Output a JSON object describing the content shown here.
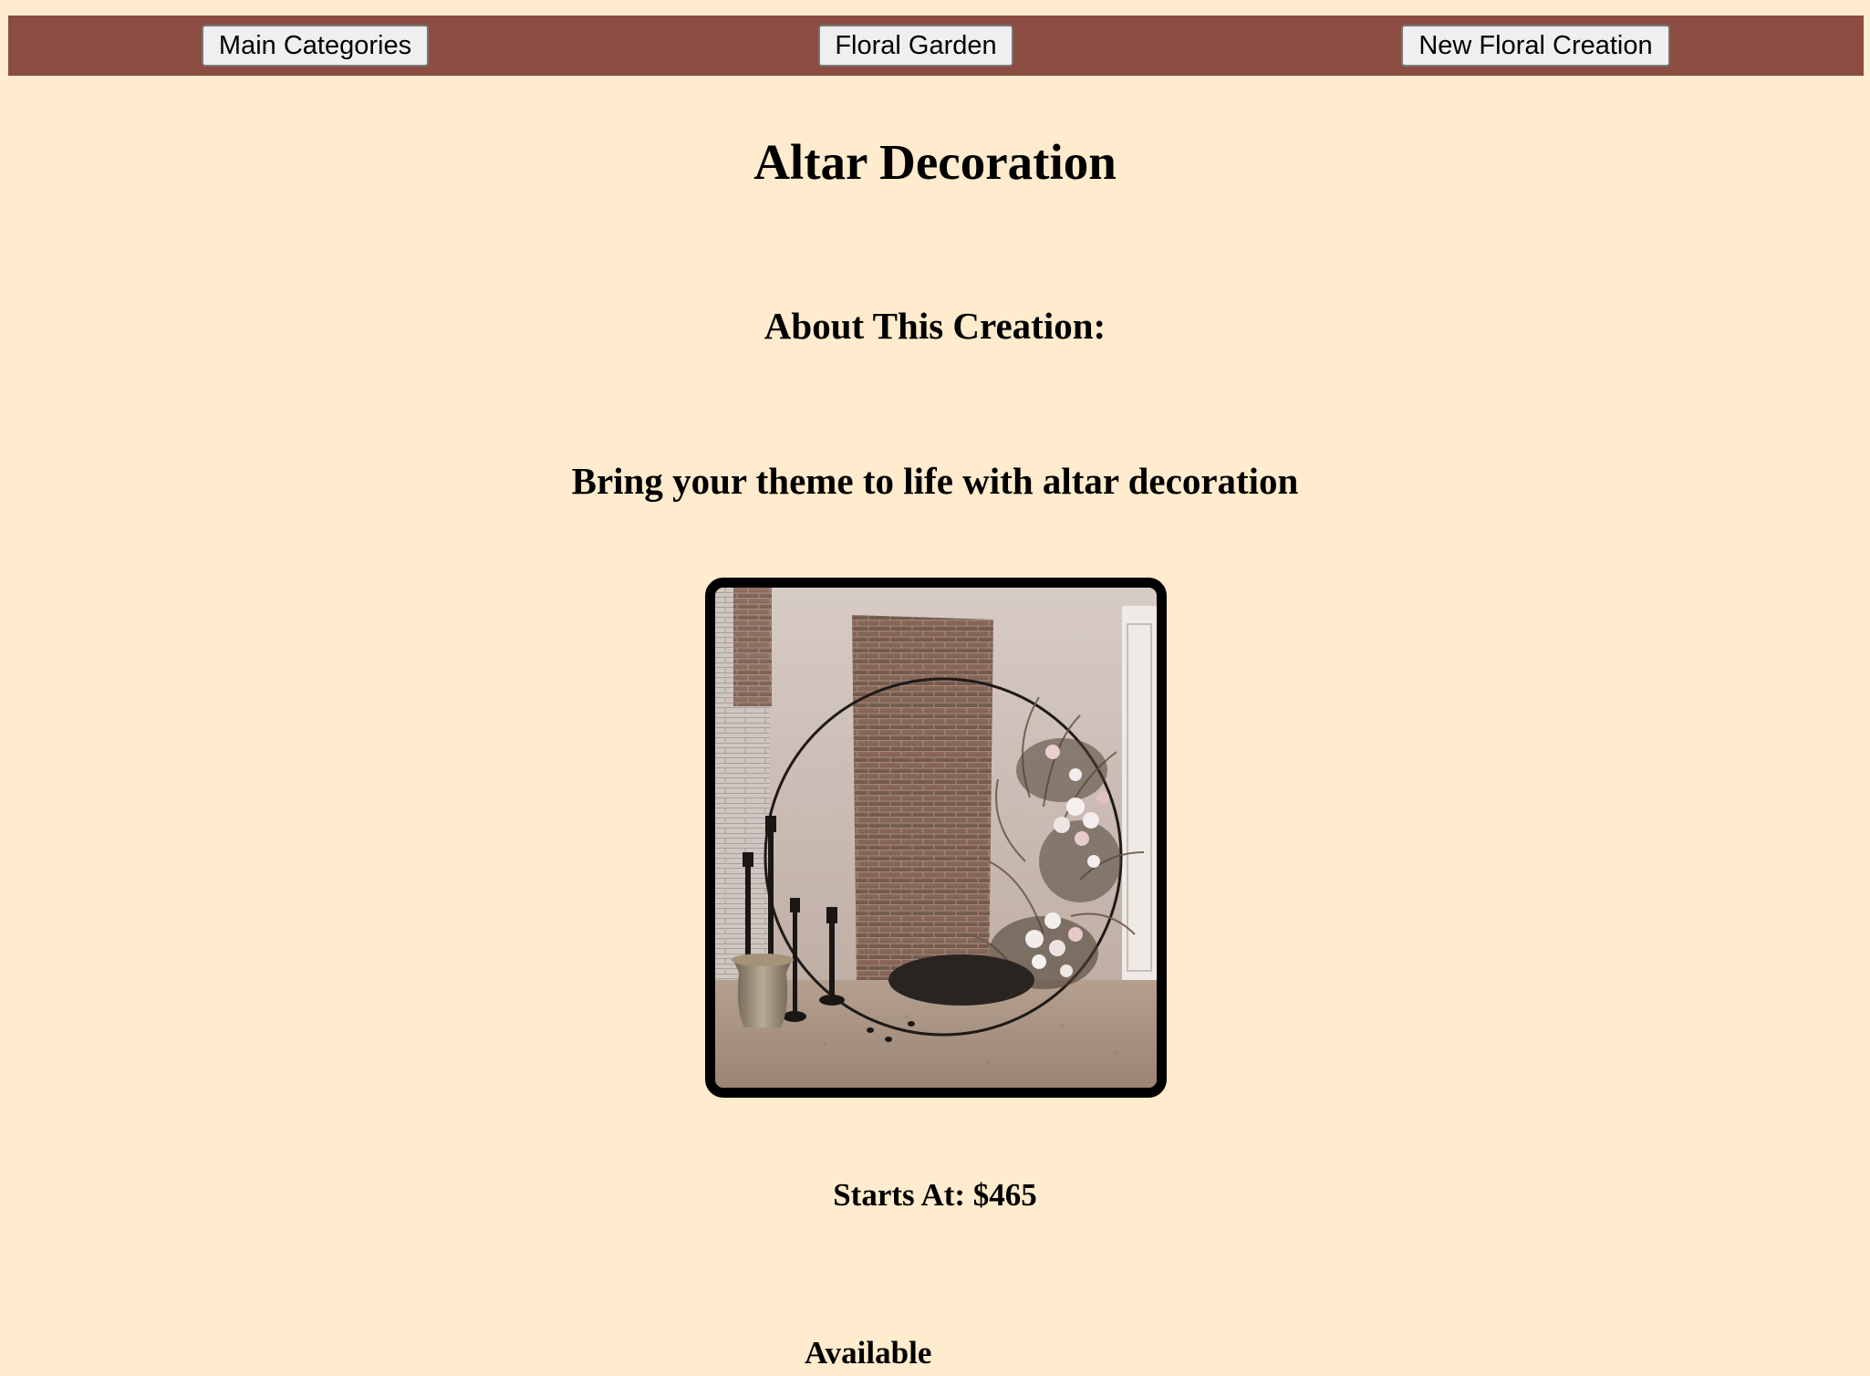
{
  "nav": {
    "main_categories": "Main Categories",
    "floral_garden": "Floral Garden",
    "new_floral_creation": "New Floral Creation"
  },
  "page": {
    "title": "Altar Decoration",
    "about_heading": "About This Creation:",
    "tagline": "Bring your theme to life with altar decoration",
    "price": "Starts At: $465",
    "availability_label": "Available"
  },
  "image": {
    "subject": "circular metal arch with dried florals and white orchids, black candlesticks, brick wall backdrop"
  },
  "colors": {
    "background": "#ffebcd",
    "navbar": "#8b4c42",
    "button_bg": "#efefef",
    "frame": "#000000"
  }
}
